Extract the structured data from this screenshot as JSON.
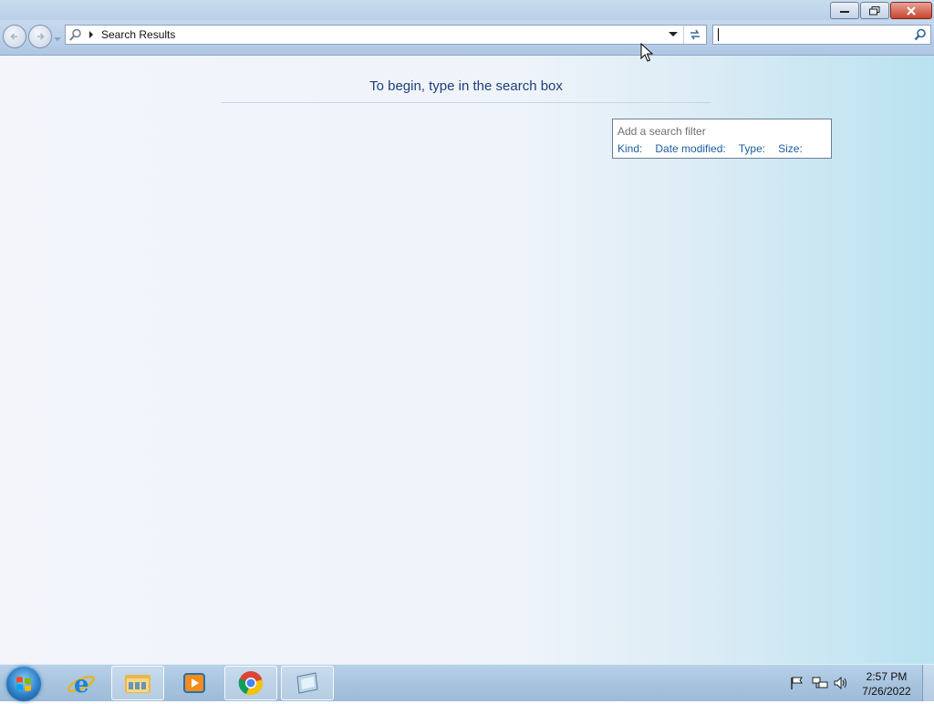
{
  "address_bar": {
    "location": "Search Results"
  },
  "search_box": {
    "value": "",
    "placeholder": ""
  },
  "content": {
    "heading": "To begin, type in the search box"
  },
  "search_filter": {
    "title": "Add a search filter",
    "filters": [
      "Kind:",
      "Date modified:",
      "Type:",
      "Size:"
    ]
  },
  "taskbar": {
    "pinned": [
      "internet-explorer",
      "windows-explorer",
      "windows-media-player",
      "google-chrome",
      "window-app"
    ],
    "time": "2:57 PM",
    "date": "7/26/2022"
  },
  "colors": {
    "accent_text": "#1e3f7a",
    "link": "#1a5e9f",
    "close_button": "#c8462f"
  }
}
